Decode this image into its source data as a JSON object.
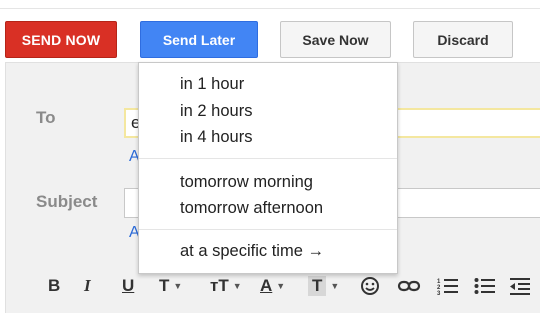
{
  "toolbar_buttons": {
    "send_now": "SEND NOW",
    "send_later": "Send Later",
    "save_now": "Save Now",
    "discard": "Discard"
  },
  "compose": {
    "to_label": "To",
    "to_value": "e",
    "to_link": "A",
    "subject_label": "Subject",
    "subject_link": "A"
  },
  "send_later_menu": {
    "items": [
      "in 1 hour",
      "in 2 hours",
      "in 4 hours",
      "tomorrow morning",
      "tomorrow afternoon",
      "at a specific time →"
    ]
  },
  "format_toolbar": {
    "bold": "B",
    "italic": "I",
    "underline": "U",
    "font": "T",
    "size": "тT",
    "text_color": "A",
    "highlight": "T",
    "emoji_icon": "smiley-icon",
    "link_icon": "link-icon",
    "numbered_list_icon": "numbered-list-icon",
    "bulleted_list_icon": "bulleted-list-icon",
    "indent_icon": "indent-less-icon"
  },
  "colors": {
    "send_now_bg": "#d93025",
    "send_later_bg": "#4285f4",
    "compose_bg": "#f1f1f1"
  }
}
